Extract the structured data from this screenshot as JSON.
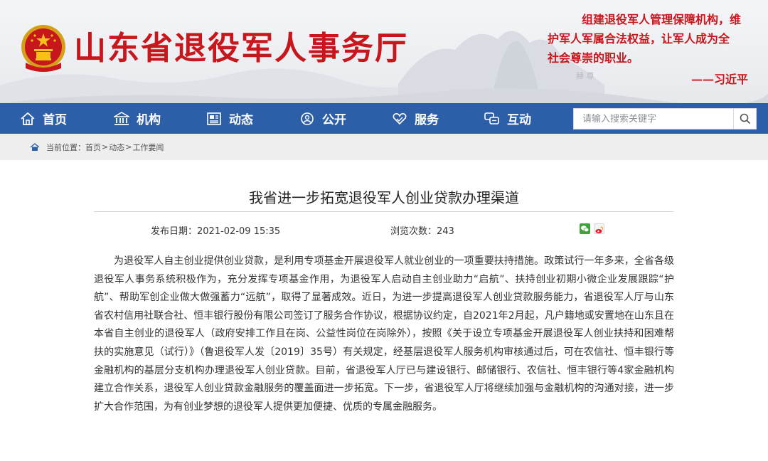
{
  "header": {
    "site_title": "山东省退役军人事务厅",
    "quote_lines": [
      "组建退役军人管理保障机构，维",
      "护军人军属合法权益，让军人成为全",
      "社会尊崇的职业。"
    ],
    "quote_author": "——习近平"
  },
  "nav": {
    "items": [
      {
        "label": "首页",
        "icon": "home-icon"
      },
      {
        "label": "机构",
        "icon": "institution-icon"
      },
      {
        "label": "动态",
        "icon": "news-icon"
      },
      {
        "label": "公开",
        "icon": "public-icon"
      },
      {
        "label": "服务",
        "icon": "heart-hand-icon"
      },
      {
        "label": "互动",
        "icon": "chat-icon"
      }
    ],
    "search_placeholder": "请输入搜索关键字"
  },
  "breadcrumb": {
    "prefix": "当前位置：",
    "items": [
      "首页",
      "动态",
      "工作要闻"
    ],
    "separator": ">"
  },
  "article": {
    "title": "我省进一步拓宽退役军人创业贷款办理渠道",
    "date_label": "发布日期：",
    "date": "2021-02-09 15:35",
    "views_label": "浏览次数：",
    "views": "243",
    "body": "为退役军人自主创业提供创业贷款，是利用专项基金开展退役军人就业创业的一项重要扶持措施。政策试行一年多来，全省各级退役军人事务系统积极作为，充分发挥专项基金作用，为退役军人启动自主创业助力“启航”、扶持创业初期小微企业发展跟踪“护航”、帮助军创企业做大做强蓄力“远航”，取得了显著成效。近日，为进一步提高退役军人创业贷款服务能力，省退役军人厅与山东省农村信用社联合社、恒丰银行股份有限公司签订了服务合作协议，根据协议约定，自2021年2月起，凡户籍地或安置地在山东且在本省自主创业的退役军人（政府安排工作且在岗、公益性岗位在岗除外），按照《关于设立专项基金开展退役军人创业扶持和困难帮扶的实施意见（试行）》（鲁退役军人发〔2019〕35号）有关规定，经基层退役军人服务机构审核通过后，可在农信社、恒丰银行等金融机构的基层分支机构办理退役军人创业贷款。目前，省退役军人厅已与建设银行、邮储银行、农信社、恒丰银行等4家金融机构建立合作关系，退役军人创业贷款金融服务的覆盖面进一步拓宽。下一步，省退役军人厅将继续加强与金融机构的沟通对接，进一步扩大合作范围，为有创业梦想的退役军人提供更加便捷、优质的专属金融服务。"
  },
  "colors": {
    "brand_red": "#c8161d",
    "nav_blue": "#2c5fa8",
    "crumb_bg": "#eeeeef"
  }
}
